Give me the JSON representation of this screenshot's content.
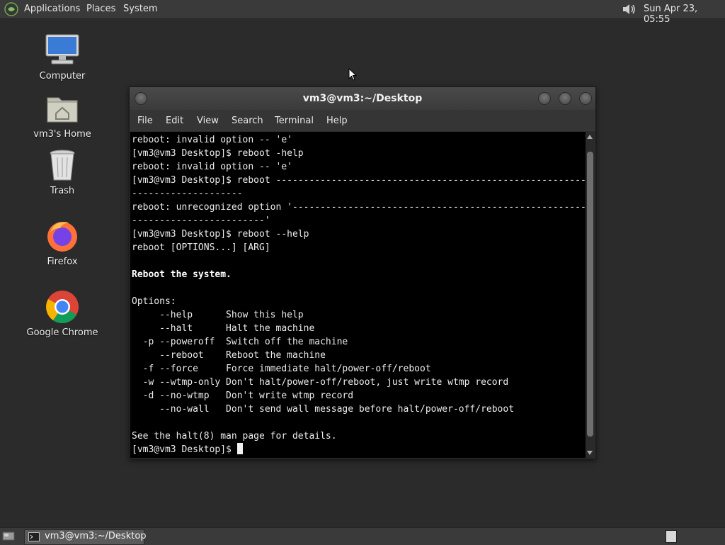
{
  "top_panel": {
    "menus": [
      "Applications",
      "Places",
      "System"
    ],
    "clock": "Sun Apr 23, 05:55",
    "volume_icon": "speaker-icon"
  },
  "desktop": {
    "icons": [
      {
        "label": "Computer",
        "icon": "computer-icon"
      },
      {
        "label": "vm3's Home",
        "icon": "home-folder-icon"
      },
      {
        "label": "Trash",
        "icon": "trash-icon"
      },
      {
        "label": "Firefox",
        "icon": "firefox-icon"
      },
      {
        "label": "Google Chrome",
        "icon": "chrome-icon"
      }
    ]
  },
  "terminal": {
    "title": "vm3@vm3:~/Desktop",
    "menu": [
      "File",
      "Edit",
      "View",
      "Search",
      "Terminal",
      "Help"
    ],
    "lines": [
      "reboot: invalid option -- 'e'",
      "[vm3@vm3 Desktop]$ reboot -help",
      "reboot: invalid option -- 'e'",
      "[vm3@vm3 Desktop]$ reboot -----------------------------------------------------------",
      "--------------------",
      "reboot: unrecognized option '---------------------------------------------------------",
      "------------------------'",
      "[vm3@vm3 Desktop]$ reboot --help",
      "reboot [OPTIONS...] [ARG]",
      "",
      "Reboot the system.",
      "",
      "Options:",
      "     --help      Show this help",
      "     --halt      Halt the machine",
      "  -p --poweroff  Switch off the machine",
      "     --reboot    Reboot the machine",
      "  -f --force     Force immediate halt/power-off/reboot",
      "  -w --wtmp-only Don't halt/power-off/reboot, just write wtmp record",
      "  -d --no-wtmp   Don't write wtmp record",
      "     --no-wall   Don't send wall message before halt/power-off/reboot",
      "",
      "See the halt(8) man page for details."
    ],
    "bold_line": "Reboot the system.",
    "prompt": "[vm3@vm3 Desktop]$ "
  },
  "taskbar": {
    "task_label": "vm3@vm3:~/Desktop"
  }
}
